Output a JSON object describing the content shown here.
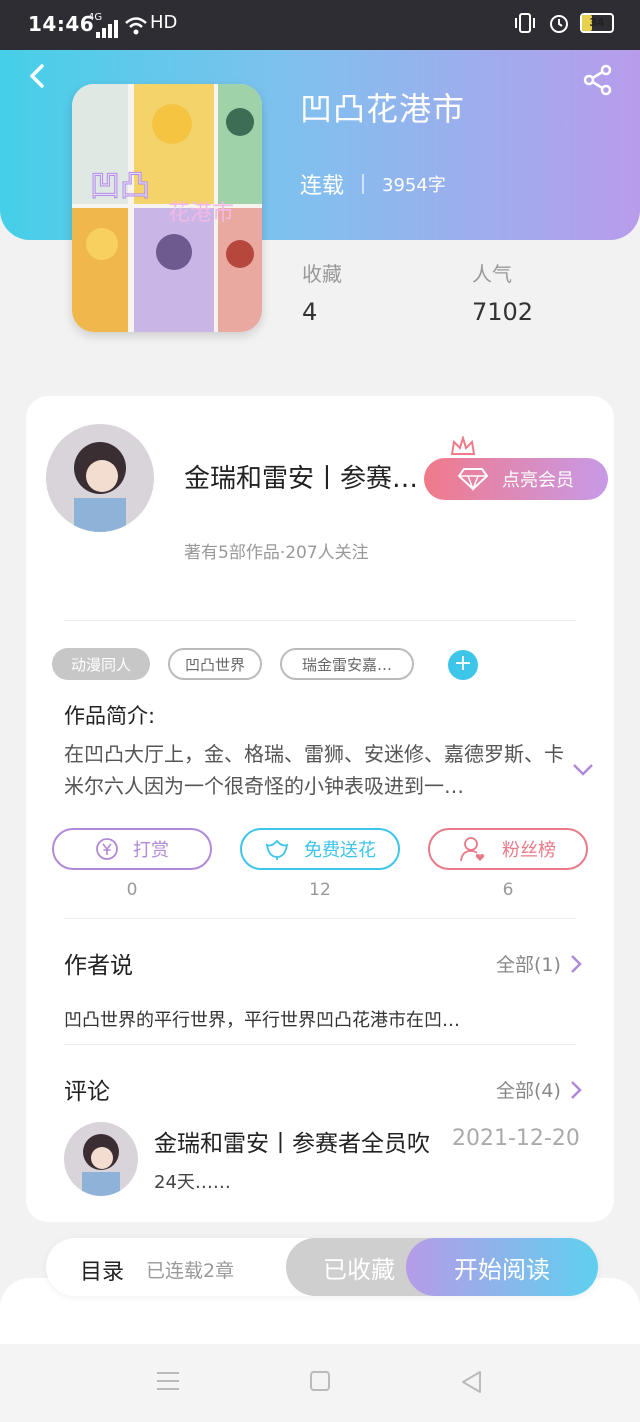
{
  "status_bar": {
    "time": "14:46",
    "network": "4G",
    "hd": "HD",
    "battery": "34",
    "battery_level": 0.34
  },
  "header": {
    "title": "凹凸花港市",
    "status": "连载",
    "word_count": "3954字",
    "cover_text": "凹凸花港市"
  },
  "stats": [
    {
      "label": "收藏",
      "value": "4"
    },
    {
      "label": "人气",
      "value": "7102"
    }
  ],
  "author": {
    "name": "金瑞和雷安丨参赛者全员吹",
    "meta": "著有5部作品·207人关注",
    "vip_label": "点亮会员"
  },
  "tags": [
    "动漫同人",
    "凹凸世界",
    "瑞金雷安嘉…"
  ],
  "intro": {
    "title": "作品简介:",
    "text": "在凹凸大厅上，金、格瑞、雷狮、安迷修、嘉德罗斯、卡米尔六人因为一个很奇怪的小钟表吸进到一…"
  },
  "actions": [
    {
      "label": "打赏",
      "count": "0",
      "color": "#b08ad8",
      "icon": "yen-icon"
    },
    {
      "label": "免费送花",
      "count": "12",
      "color": "#3ec5ea",
      "icon": "flower-icon"
    },
    {
      "label": "粉丝榜",
      "count": "6",
      "color": "#e87a8a",
      "icon": "fan-icon"
    }
  ],
  "author_says": {
    "title": "作者说",
    "see_all": "全部(1)",
    "text": "凹凸世界的平行世界，平行世界凹凸花港市在凹…"
  },
  "comments": {
    "title": "评论",
    "see_all": "全部(4)",
    "items": [
      {
        "name": "金瑞和雷安丨参赛者全员吹",
        "date": "2021-12-20",
        "text": "24天……"
      }
    ]
  },
  "bottom": {
    "toc": "目录",
    "chapters": "已连载2章",
    "collected": "已收藏",
    "start": "开始阅读"
  }
}
